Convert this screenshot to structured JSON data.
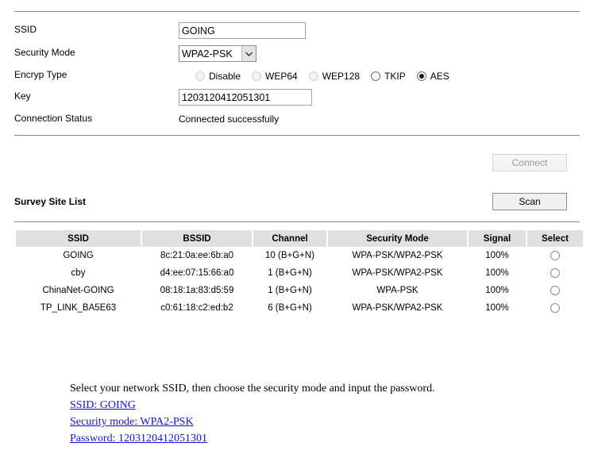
{
  "form": {
    "rows": [
      {
        "label": "SSID"
      },
      {
        "label": "Security Mode"
      },
      {
        "label": "Encryp Type"
      },
      {
        "label": "Key"
      },
      {
        "label": "Connection Status"
      }
    ],
    "ssid_value": "GOING",
    "ssid_placeholder": "",
    "security_mode_value": "WPA2-PSK",
    "security_mode_options": [
      "WPA2-PSK"
    ],
    "encryp_types": [
      {
        "label": "Disable",
        "checked": false,
        "disabled": true
      },
      {
        "label": "WEP64",
        "checked": false,
        "disabled": true
      },
      {
        "label": "WEP128",
        "checked": false,
        "disabled": true
      },
      {
        "label": "TKIP",
        "checked": false,
        "disabled": false
      },
      {
        "label": "AES",
        "checked": true,
        "disabled": false
      }
    ],
    "key_value": "1203120412051301",
    "key_placeholder": "",
    "connection_status": "Connected successfully"
  },
  "buttons": {
    "connect_label": "Connect",
    "scan_label": "Scan"
  },
  "survey": {
    "title": "Survey Site List",
    "columns": [
      "SSID",
      "BSSID",
      "Channel",
      "Security Mode",
      "Signal",
      "Select"
    ],
    "rows": [
      {
        "ssid": "GOING",
        "bssid": "8c:21:0a:ee:6b:a0",
        "channel": "10 (B+G+N)",
        "security": "WPA-PSK/WPA2-PSK",
        "signal": "100%",
        "selected": false
      },
      {
        "ssid": "cby",
        "bssid": "d4:ee:07:15:66:a0",
        "channel": "1 (B+G+N)",
        "security": "WPA-PSK/WPA2-PSK",
        "signal": "100%",
        "selected": false
      },
      {
        "ssid": "ChinaNet-GOING",
        "bssid": "08:18:1a:83:d5:59",
        "channel": "1 (B+G+N)",
        "security": "WPA-PSK",
        "signal": "100%",
        "selected": false
      },
      {
        "ssid": "TP_LINK_BA5E63",
        "bssid": "c0:61:18:c2:ed:b2",
        "channel": "6 (B+G+N)",
        "security": "WPA-PSK/WPA2-PSK",
        "signal": "100%",
        "selected": false
      }
    ]
  },
  "instructions": {
    "note": "Select your network SSID, then choose the security mode and input the password.",
    "links": [
      "SSID: GOING",
      "Security mode: WPA2-PSK",
      "Password: 1203120412051301"
    ]
  },
  "colors": {
    "link": "#1414d2",
    "header_bg": "#e0e0e0",
    "rule": "#8a8a8a",
    "disabled_text": "#9a9a9a"
  }
}
